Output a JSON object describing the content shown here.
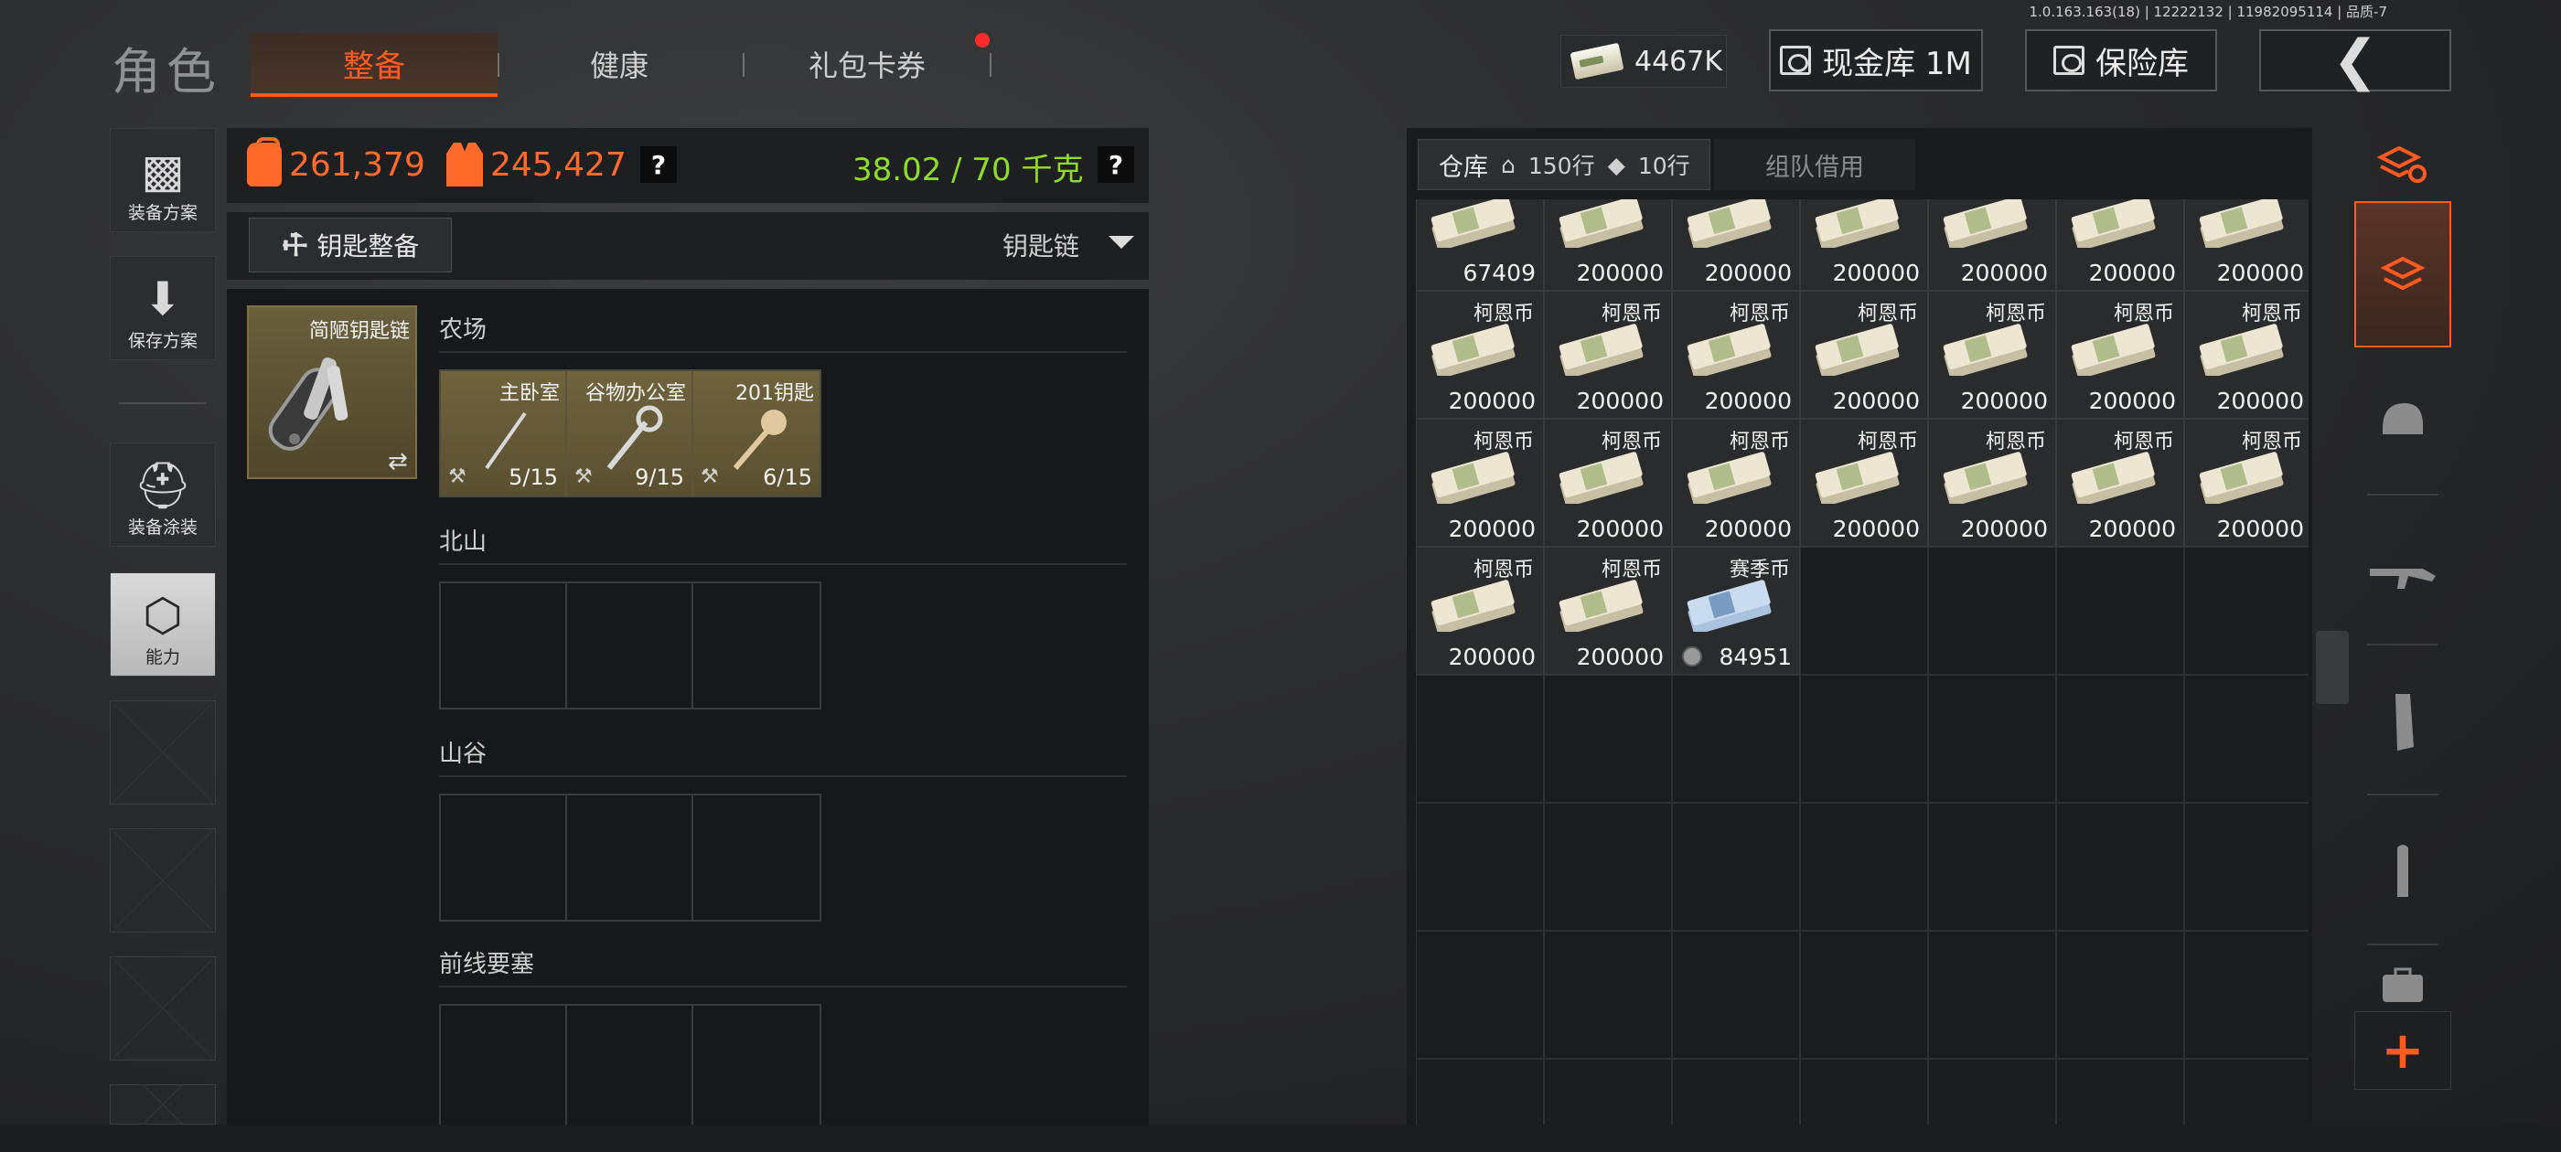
{
  "version": "1.0.163.163(18) | 12222132 | 11982095114 | 品质-7",
  "header": {
    "title": "角色",
    "tabs": [
      {
        "label": "整备",
        "active": true
      },
      {
        "label": "健康",
        "active": false
      },
      {
        "label": "礼包卡券",
        "active": false,
        "notification": true
      }
    ],
    "money": "4467K",
    "cash_vault_label": "现金库 1M",
    "safe_label": "保险库"
  },
  "sidebar": {
    "items": [
      {
        "label": "装备方案",
        "icon": "vest-icon"
      },
      {
        "label": "保存方案",
        "icon": "download-icon"
      },
      {
        "label": "装备涂装",
        "icon": "helmet-icon"
      },
      {
        "label": "能力",
        "icon": "hex-lightning-icon",
        "active": true
      }
    ]
  },
  "stats": {
    "bag_value": "261,379",
    "gear_value": "245,427",
    "help": "?",
    "weight": "38.02 / 70 千克"
  },
  "key_section": {
    "button_label": "钥匙整备",
    "dropdown_label": "钥匙链",
    "keyring_name": "简陋钥匙链",
    "swap_icon": "⇄",
    "groups": [
      {
        "title": "农场",
        "slots": [
          {
            "name": "主卧室",
            "count": "5/15"
          },
          {
            "name": "谷物办公室",
            "count": "9/15"
          },
          {
            "name": "201钥匙",
            "count": "6/15"
          }
        ]
      },
      {
        "title": "北山",
        "slots": []
      },
      {
        "title": "山谷",
        "slots": []
      },
      {
        "title": "前线要塞",
        "slots": []
      }
    ]
  },
  "stash": {
    "tab_label": "仓库",
    "rows_home": "150行",
    "rows_tag": "10行",
    "team_tab": "组队借用",
    "items": [
      {
        "name": "",
        "count": "67409"
      },
      {
        "name": "",
        "count": "200000"
      },
      {
        "name": "",
        "count": "200000"
      },
      {
        "name": "",
        "count": "200000"
      },
      {
        "name": "",
        "count": "200000"
      },
      {
        "name": "",
        "count": "200000"
      },
      {
        "name": "",
        "count": "200000"
      },
      {
        "name": "柯恩币",
        "count": "200000"
      },
      {
        "name": "柯恩币",
        "count": "200000"
      },
      {
        "name": "柯恩币",
        "count": "200000"
      },
      {
        "name": "柯恩币",
        "count": "200000"
      },
      {
        "name": "柯恩币",
        "count": "200000"
      },
      {
        "name": "柯恩币",
        "count": "200000"
      },
      {
        "name": "柯恩币",
        "count": "200000"
      },
      {
        "name": "柯恩币",
        "count": "200000"
      },
      {
        "name": "柯恩币",
        "count": "200000"
      },
      {
        "name": "柯恩币",
        "count": "200000"
      },
      {
        "name": "柯恩币",
        "count": "200000"
      },
      {
        "name": "柯恩币",
        "count": "200000"
      },
      {
        "name": "柯恩币",
        "count": "200000"
      },
      {
        "name": "柯恩币",
        "count": "200000"
      },
      {
        "name": "柯恩币",
        "count": "200000"
      },
      {
        "name": "柯恩币",
        "count": "200000"
      },
      {
        "name": "赛季币",
        "count": "84951",
        "season": true
      }
    ]
  },
  "right_sidebar": {
    "icons": [
      "stash-swap-icon",
      "layers-icon",
      "helmet-icon",
      "rifle-icon",
      "magazine-icon",
      "ammo-icon",
      "medkit-icon"
    ],
    "add": "+"
  },
  "colors": {
    "accent": "#ff5a1f",
    "weight": "#8fdb2b",
    "stat": "#ff6a2b"
  }
}
